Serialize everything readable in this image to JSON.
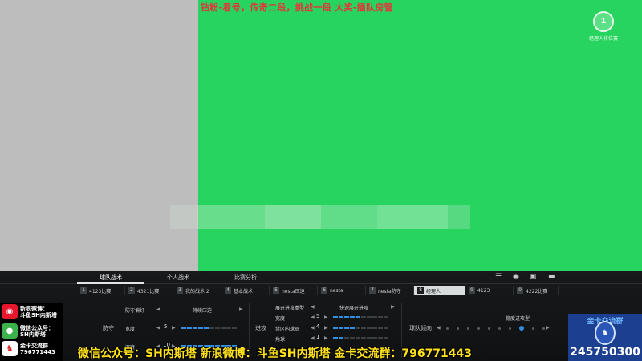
{
  "stream": {
    "top_banner": "钻粉-看号，传奇二段，挑战一段 大奖-插队房管",
    "bottom_overlay": "微信公众号：SH内斯塔    新浪微博：斗鱼SH内斯塔    金卡交流群：796771443",
    "social": [
      {
        "icon": "weibo-icon",
        "label_line1": "新浪微博：",
        "label_line2": "斗鱼SH内斯塔"
      },
      {
        "icon": "wechat-icon",
        "label_line1": "微信公众号：",
        "label_line2": "SH内斯塔"
      },
      {
        "icon": "chelsea-icon",
        "label_line1": "金卡交流群",
        "label_line2": "796771443"
      }
    ],
    "club": {
      "title": "金卡交流群",
      "number": "245750300"
    }
  },
  "game": {
    "logo_label": "经理人排位赛",
    "logo_mark": "1",
    "main_tabs": [
      {
        "label": "球队战术",
        "active": true
      },
      {
        "label": "个人战术",
        "active": false
      },
      {
        "label": "比赛分析",
        "active": false
      }
    ],
    "toolbar_icons": [
      "menu-icon",
      "eye-icon",
      "save-icon",
      "minimize-icon"
    ],
    "presets": [
      {
        "num": "1",
        "label": "4123比赛"
      },
      {
        "num": "2",
        "label": "4321比赛"
      },
      {
        "num": "3",
        "label": "我的战术 2"
      },
      {
        "num": "4",
        "label": "基本战术"
      },
      {
        "num": "5",
        "label": "nesta压迫"
      },
      {
        "num": "6",
        "label": "nesta"
      },
      {
        "num": "7",
        "label": "nesta防守"
      },
      {
        "num": "8",
        "label": "经理人",
        "active": true
      },
      {
        "num": "9",
        "label": "4123"
      },
      {
        "num": "0",
        "label": "4222比赛"
      }
    ],
    "defense": {
      "section": "防守",
      "style_label": "防守偏好",
      "style_value": "持续压迫",
      "width_label": "宽度",
      "width_value": "5",
      "depth_label": "深度",
      "depth_value": "10"
    },
    "attack": {
      "section": "进攻",
      "buildup_label": "展开进攻类型",
      "buildup_value": "快速展开进攻",
      "width_label": "宽度",
      "width_value": "5",
      "box_label": "禁区内球员",
      "box_value": "4",
      "corner_label": "角球",
      "corner_value": "1"
    },
    "team": {
      "section": "球队倾向",
      "type_label": "稳度进攻型"
    }
  },
  "colors": {
    "green_screen": "#26d45f",
    "bar_on": "#2f8fe0",
    "banner_red": "#e8323a",
    "overlay_yellow": "#ffe21a"
  }
}
